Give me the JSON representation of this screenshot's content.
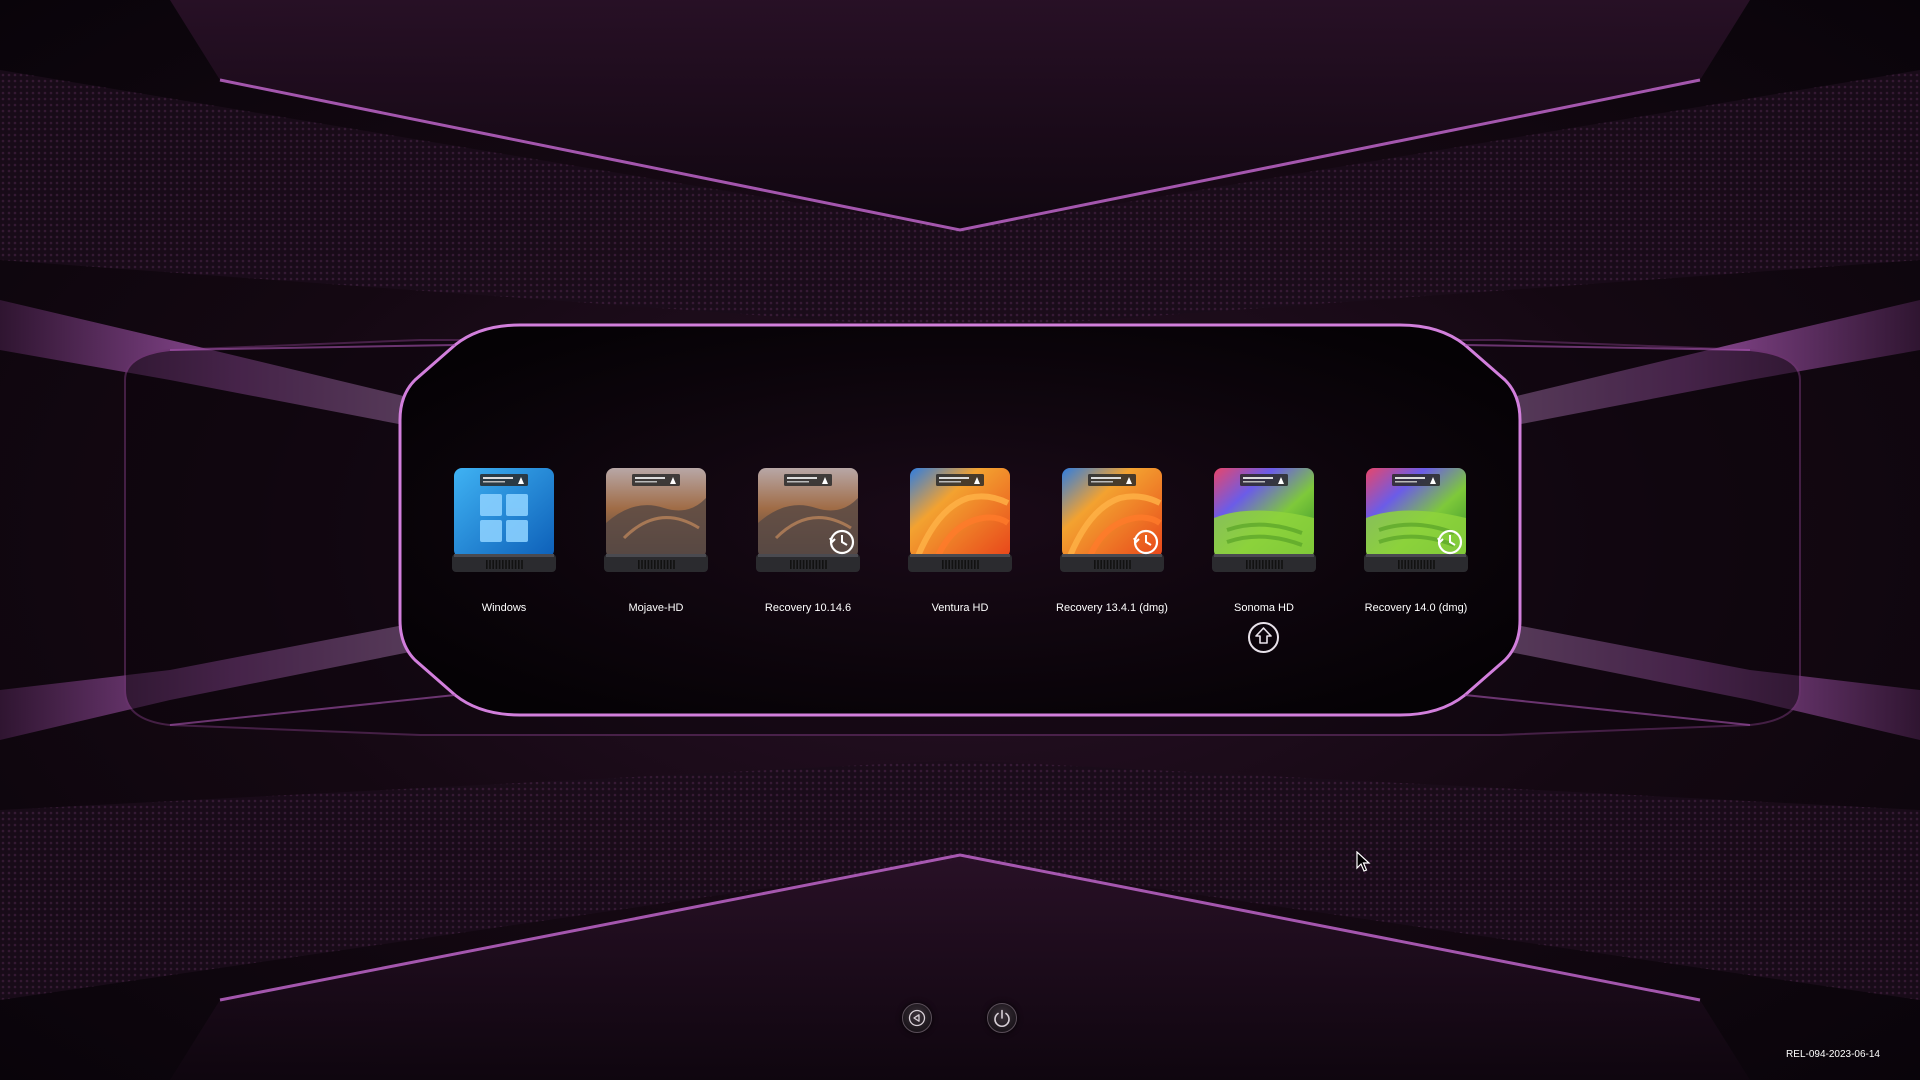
{
  "drives": [
    {
      "label": "Windows",
      "theme": "windows",
      "recovery": false
    },
    {
      "label": "Mojave-HD",
      "theme": "mojave",
      "recovery": false
    },
    {
      "label": "Recovery 10.14.6",
      "theme": "mojave",
      "recovery": true
    },
    {
      "label": "Ventura HD",
      "theme": "ventura",
      "recovery": false
    },
    {
      "label": "Recovery 13.4.1 (dmg)",
      "theme": "ventura",
      "recovery": true
    },
    {
      "label": "Sonoma HD",
      "theme": "sonoma",
      "recovery": false
    },
    {
      "label": "Recovery 14.0 (dmg)",
      "theme": "sonoma",
      "recovery": true
    }
  ],
  "selected_drive": "Sonoma HD",
  "eject_icon": "eject-up-arrow-icon",
  "controls": {
    "back_icon": "back-arrow-icon",
    "power_icon": "power-icon"
  },
  "version": "REL-094-2023-06-14",
  "colors": {
    "accent": "#c86ad4",
    "background": "#140812",
    "text": "#ffffff"
  }
}
